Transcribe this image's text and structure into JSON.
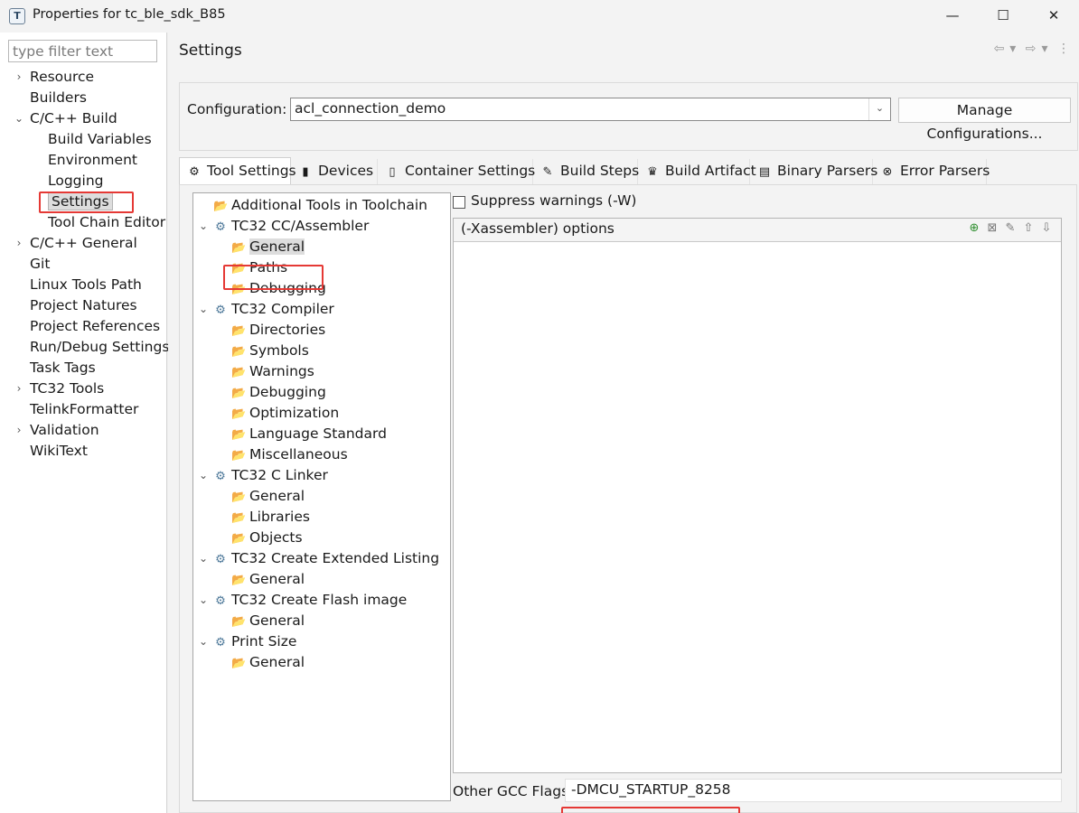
{
  "window": {
    "title": "Properties for tc_ble_sdk_B85",
    "app_icon_glyph": "T",
    "min_glyph": "—",
    "max_glyph": "☐",
    "close_glyph": "✕"
  },
  "left_nav": {
    "filter_placeholder": "type filter text",
    "items": [
      {
        "label": "Resource",
        "expander": "›"
      },
      {
        "label": "Builders"
      },
      {
        "label": "C/C++ Build",
        "expander": "⌄"
      },
      {
        "label": "Build Variables"
      },
      {
        "label": "Environment"
      },
      {
        "label": "Logging"
      },
      {
        "label": "Settings",
        "selected": true
      },
      {
        "label": "Tool Chain Editor"
      },
      {
        "label": "C/C++ General",
        "expander": "›"
      },
      {
        "label": "Git"
      },
      {
        "label": "Linux Tools Path"
      },
      {
        "label": "Project Natures"
      },
      {
        "label": "Project References"
      },
      {
        "label": "Run/Debug Settings"
      },
      {
        "label": "Task Tags"
      },
      {
        "label": "TC32 Tools",
        "expander": "›"
      },
      {
        "label": "TelinkFormatter"
      },
      {
        "label": "Validation",
        "expander": "›"
      },
      {
        "label": "WikiText"
      }
    ]
  },
  "page": {
    "title": "Settings",
    "nav_icons": [
      "back-arrow-icon",
      "forward-arrow-icon",
      "view-menu-icon"
    ]
  },
  "configuration": {
    "label": "Configuration:",
    "value": "acl_connection_demo",
    "manage_button": "Manage Configurations..."
  },
  "tabs": [
    {
      "label": "Tool Settings",
      "icon": "tool-settings-icon",
      "glyph": "⚙",
      "active": true
    },
    {
      "label": "Devices",
      "icon": "devices-icon",
      "glyph": "▮"
    },
    {
      "label": "Container Settings",
      "icon": "container-icon",
      "glyph": "▯"
    },
    {
      "label": "Build Steps",
      "icon": "build-steps-icon",
      "glyph": "✎"
    },
    {
      "label": "Build Artifact",
      "icon": "build-artifact-icon",
      "glyph": "♛"
    },
    {
      "label": "Binary Parsers",
      "icon": "binary-parsers-icon",
      "glyph": "▤"
    },
    {
      "label": "Error Parsers",
      "icon": "error-parsers-icon",
      "glyph": "⊗"
    }
  ],
  "tool_tree": {
    "nodes": [
      {
        "label": "Additional Tools in Toolchain",
        "type": "folder"
      },
      {
        "label": "TC32 CC/Assembler",
        "type": "tool",
        "expander": "⌄"
      },
      {
        "label": "General",
        "type": "folder",
        "selected": true
      },
      {
        "label": "Paths",
        "type": "folder"
      },
      {
        "label": "Debugging",
        "type": "folder"
      },
      {
        "label": "TC32 Compiler",
        "type": "tool",
        "expander": "⌄"
      },
      {
        "label": "Directories",
        "type": "folder"
      },
      {
        "label": "Symbols",
        "type": "folder"
      },
      {
        "label": "Warnings",
        "type": "folder"
      },
      {
        "label": "Debugging",
        "type": "folder"
      },
      {
        "label": "Optimization",
        "type": "folder"
      },
      {
        "label": "Language Standard",
        "type": "folder"
      },
      {
        "label": "Miscellaneous",
        "type": "folder"
      },
      {
        "label": "TC32 C Linker",
        "type": "tool",
        "expander": "⌄"
      },
      {
        "label": "General",
        "type": "folder"
      },
      {
        "label": "Libraries",
        "type": "folder"
      },
      {
        "label": "Objects",
        "type": "folder"
      },
      {
        "label": "TC32 Create Extended Listing",
        "type": "tool",
        "expander": "⌄"
      },
      {
        "label": "General",
        "type": "folder"
      },
      {
        "label": "TC32 Create Flash image",
        "type": "tool",
        "expander": "⌄"
      },
      {
        "label": "General",
        "type": "folder"
      },
      {
        "label": "Print Size",
        "type": "tool",
        "expander": "⌄"
      },
      {
        "label": "General",
        "type": "folder"
      }
    ],
    "gear_glyph": "⚙",
    "folder_glyph": "📂"
  },
  "options": {
    "suppress_warnings_label": "Suppress warnings (-W)",
    "suppress_warnings_checked": false,
    "list_title": "(-Xassembler) options",
    "list_icons": [
      "add-icon",
      "delete-icon",
      "edit-icon",
      "move-up-icon",
      "move-down-icon"
    ],
    "list_glyphs": [
      "⊕",
      "⊠",
      "✎",
      "⇧",
      "⇩"
    ],
    "other_flags_label": "Other GCC Flags",
    "other_flags_value": "-DMCU_STARTUP_8258"
  }
}
